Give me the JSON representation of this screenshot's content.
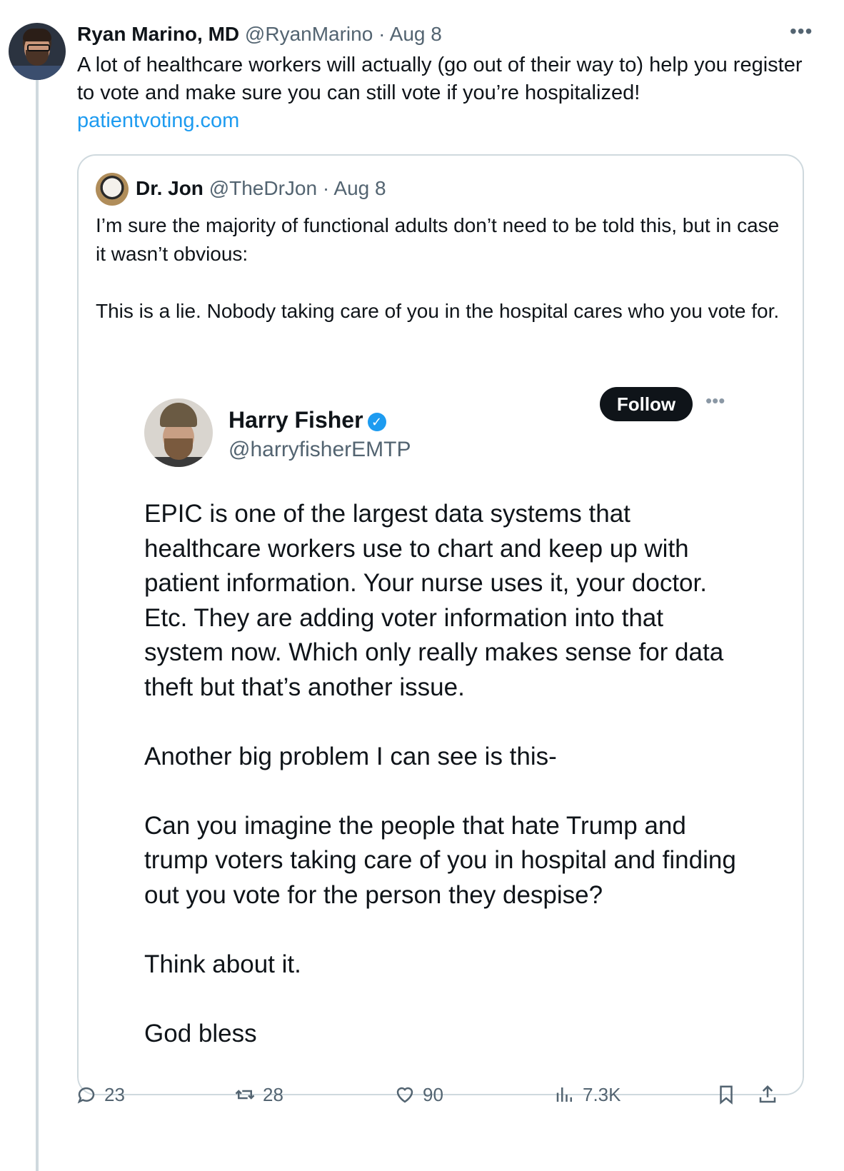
{
  "main_tweet": {
    "author_name": "Ryan Marino, MD",
    "handle": "@RyanMarino",
    "date": "· Aug 8",
    "text": "A lot of healthcare workers will actually (go out of their way to) help you register to vote and make sure you can still vote if you’re hospitalized!",
    "link": "patientvoting.com",
    "more_icon": "more-horizontal-icon"
  },
  "quoted_tweet": {
    "author_name": "Dr. Jon",
    "handle": "@TheDrJon",
    "date": "· Aug 8",
    "paragraphs": [
      "I’m sure the majority of functional adults don’t need to be told this, but in case it wasn’t obvious:",
      "This is a lie. Nobody taking care of you in the hospital cares who you vote for."
    ]
  },
  "embedded_post": {
    "author_name": "Harry Fisher",
    "handle": "@harryfisherEMTP",
    "follow_label": "Follow",
    "verified_color": "#1d9bf0",
    "paragraphs": [
      "EPIC is one of the largest data systems that healthcare workers use to chart and keep up with patient information. Your nurse uses it, your doctor. Etc. They are adding voter information into that system now. Which only really makes sense for data theft but that’s another issue.",
      "Another big problem I can see is this-",
      "Can you imagine the people that hate Trump and trump voters taking care of you in hospital and finding out you vote for the person they despise?",
      "Think about it.",
      "God bless"
    ]
  },
  "actions": {
    "replies": "23",
    "reposts": "28",
    "likes": "90",
    "views": "7.3K"
  },
  "colors": {
    "link": "#1d9bf0",
    "muted": "#536471",
    "border": "#cfd9de",
    "text": "#0f1419"
  }
}
